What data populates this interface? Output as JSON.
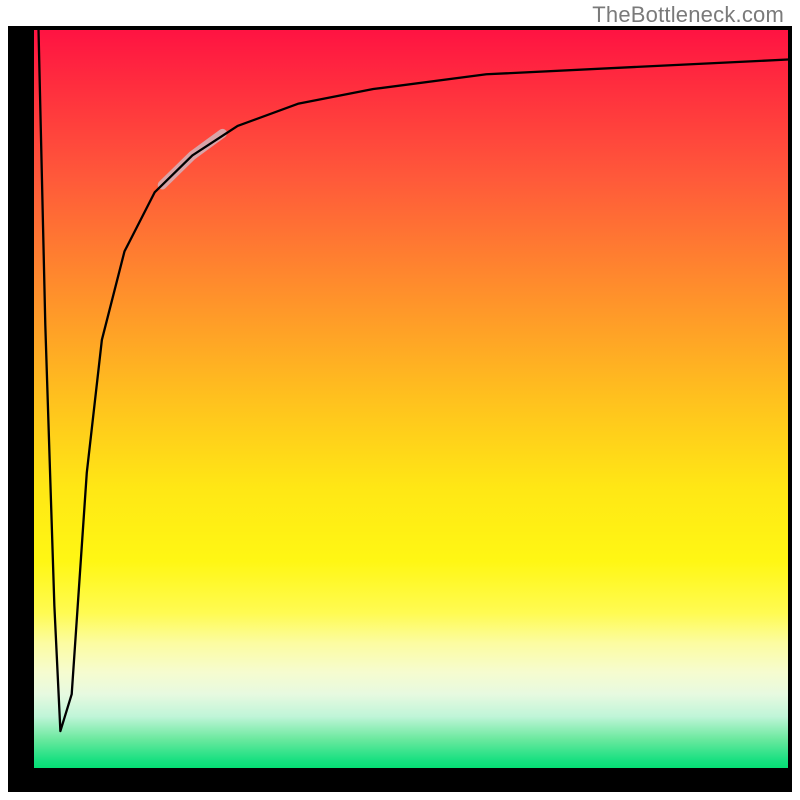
{
  "watermark": "TheBottleneck.com",
  "chart_data": {
    "type": "line",
    "title": "",
    "xlabel": "",
    "ylabel": "",
    "xlim": [
      0,
      100
    ],
    "ylim": [
      0,
      100
    ],
    "grid": false,
    "legend": null,
    "annotations": [],
    "background_gradient": {
      "orientation": "vertical",
      "stops": [
        {
          "pos": 0.0,
          "color": "#ff1442"
        },
        {
          "pos": 0.5,
          "color": "#ffc61e"
        },
        {
          "pos": 0.72,
          "color": "#fff714"
        },
        {
          "pos": 0.9,
          "color": "#c0f5d8"
        },
        {
          "pos": 1.0,
          "color": "#05df74"
        }
      ]
    },
    "series": [
      {
        "name": "bottleneck-curve",
        "color": "#000000",
        "x": [
          0.6,
          1.5,
          2.7,
          3.5,
          5,
          7,
          9,
          12,
          16,
          21,
          27,
          35,
          45,
          60,
          80,
          100
        ],
        "y": [
          100,
          60,
          22,
          5,
          10,
          40,
          58,
          70,
          78,
          83,
          87,
          90,
          92,
          94,
          95,
          96
        ]
      },
      {
        "name": "highlight-segment",
        "color": "#d9a4a8",
        "thick": true,
        "x": [
          17,
          19,
          21,
          23,
          25
        ],
        "y": [
          79,
          81,
          83,
          84.5,
          86
        ]
      }
    ],
    "notes": "Axis tick labels are not rendered in the image; values are estimated from curve geometry on a 0–100 normalized scale."
  }
}
